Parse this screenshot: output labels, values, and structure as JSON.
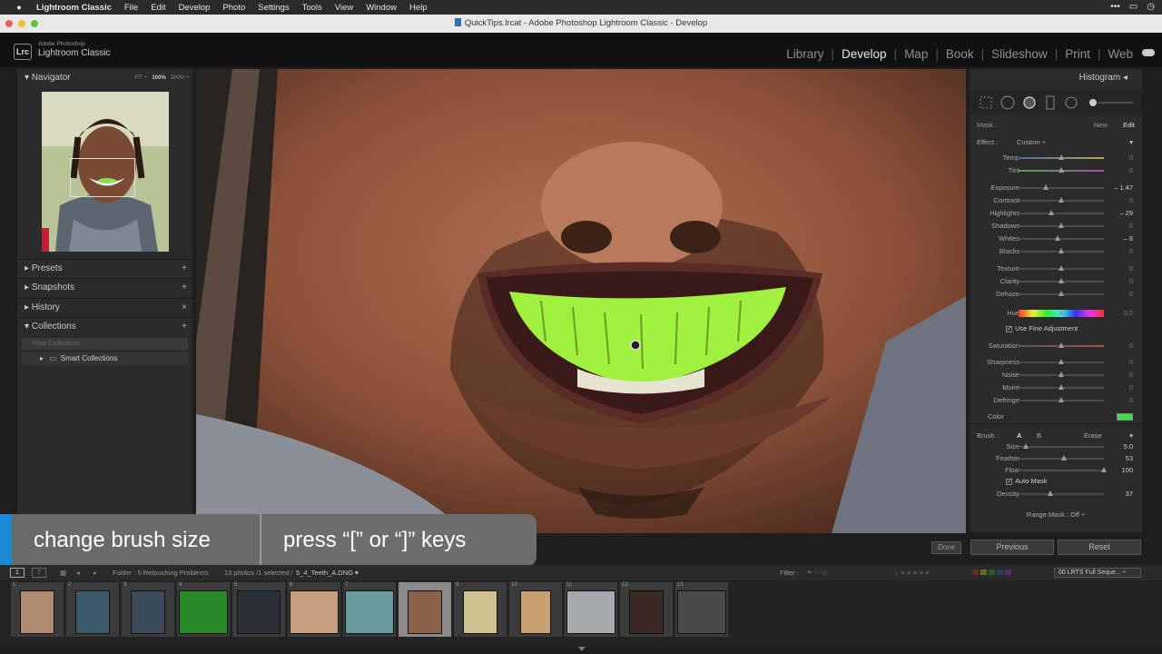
{
  "menubar": {
    "app": "Lightroom Classic",
    "items": [
      "File",
      "Edit",
      "Develop",
      "Photo",
      "Settings",
      "Tools",
      "View",
      "Window",
      "Help"
    ]
  },
  "window": {
    "title": "QuickTips.lrcat - Adobe Photoshop Lightroom Classic - Develop"
  },
  "brand": {
    "badge": "Lrc",
    "line1": "Adobe Photoshop",
    "line2": "Lightroom Classic"
  },
  "modules": {
    "items": [
      "Library",
      "Develop",
      "Map",
      "Book",
      "Slideshow",
      "Print",
      "Web"
    ],
    "active": "Develop"
  },
  "left": {
    "navigator": "Navigator",
    "zoom": [
      "FIT ÷",
      "100%",
      "200% ÷"
    ],
    "presets": "Presets",
    "snapshots": "Snapshots",
    "history": "History",
    "history_icon": "×",
    "collections": "Collections",
    "filter_placeholder": "Filter Collections",
    "smart": "Smart Collections"
  },
  "right": {
    "histogram": "Histogram",
    "mask": {
      "label": "Mask :",
      "new": "New",
      "edit": "Edit"
    },
    "effect": {
      "label": "Effect :",
      "value": "Custom ÷"
    },
    "sliders": [
      {
        "label": "Temp",
        "value": "0"
      },
      {
        "label": "Tint",
        "value": "0"
      },
      {
        "label": "Exposure",
        "value": "– 1.47"
      },
      {
        "label": "Contrast",
        "value": "0"
      },
      {
        "label": "Highlights",
        "value": "– 29"
      },
      {
        "label": "Shadows",
        "value": "0"
      },
      {
        "label": "Whites",
        "value": "– 8"
      },
      {
        "label": "Blacks",
        "value": "0"
      },
      {
        "label": "Texture",
        "value": "0"
      },
      {
        "label": "Clarity",
        "value": "0"
      },
      {
        "label": "Dehaze",
        "value": "0"
      },
      {
        "label": "Hue",
        "value": "0.0"
      },
      {
        "label": "Saturation",
        "value": "0"
      },
      {
        "label": "Sharpness",
        "value": "0"
      },
      {
        "label": "Noise",
        "value": "0"
      },
      {
        "label": "Moiré",
        "value": "0"
      },
      {
        "label": "Defringe",
        "value": "0"
      }
    ],
    "fine_adjust": "Use Fine Adjustment",
    "color": "Color",
    "color_swatch": "#35e04a",
    "brush": {
      "label": "Brush :",
      "a": "A",
      "b": "B",
      "erase": "Erase"
    },
    "brush_sliders": [
      {
        "label": "Size",
        "value": "5.0"
      },
      {
        "label": "Feather",
        "value": "53"
      },
      {
        "label": "Flow",
        "value": "100"
      },
      {
        "label": "Density",
        "value": "37"
      }
    ],
    "auto_mask": "Auto Mask",
    "range_mask": "Range Mask : Off ÷",
    "previous": "Previous",
    "reset": "Reset"
  },
  "done": "Done",
  "caption": {
    "left": "change brush size",
    "right": "press “[” or “]” keys"
  },
  "status": {
    "page1": "1",
    "page2": "2",
    "folder": "Folder : 5 Retouching Problems",
    "count": "13 photos /1 selected /",
    "file": "5_4_Teeth_A.DNG ▾",
    "filter": "Filter :",
    "preset": "00 LRTS Full Seque... ÷"
  },
  "filmstrip": [
    "1",
    "2",
    "3",
    "4",
    "5",
    "6",
    "7",
    "8",
    "9",
    "10",
    "11",
    "12",
    "13"
  ]
}
